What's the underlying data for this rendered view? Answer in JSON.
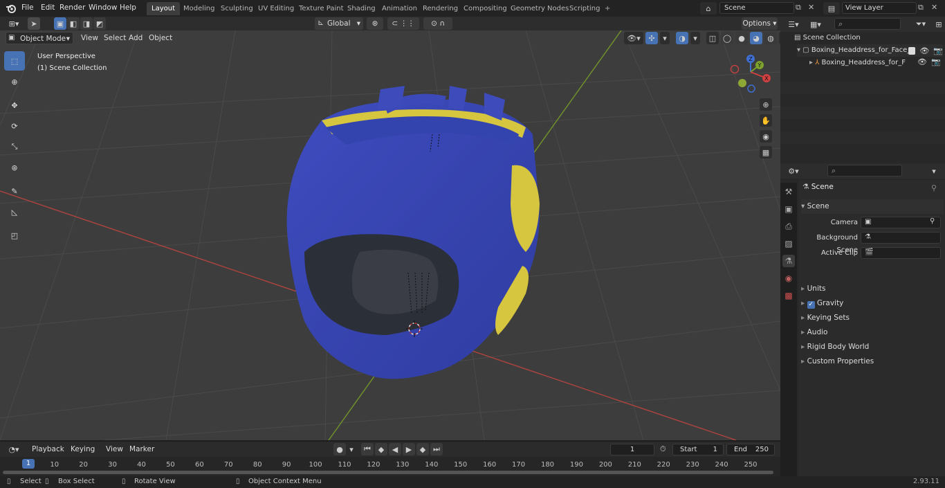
{
  "topbar": {
    "menus": [
      "File",
      "Edit",
      "Render",
      "Window",
      "Help"
    ],
    "workspaces": [
      "Layout",
      "Modeling",
      "Sculpting",
      "UV Editing",
      "Texture Paint",
      "Shading",
      "Animation",
      "Rendering",
      "Compositing",
      "Geometry Nodes",
      "Scripting"
    ],
    "active_workspace": "Layout",
    "add_tab": "+",
    "scene": "Scene",
    "view_layer": "View Layer"
  },
  "viewport_header": {
    "mode": "Object Mode",
    "menus": [
      "View",
      "Select",
      "Add",
      "Object"
    ],
    "orientation": "Global",
    "options": "Options"
  },
  "viewport": {
    "perspective_label": "User Perspective",
    "collection_label": "(1) Scene Collection",
    "gizmo": {
      "x": "X",
      "y": "Y",
      "z": "Z"
    },
    "colors": {
      "background": "#3d3d3d",
      "helmet": "#3b48b5",
      "trim": "#cfc23a",
      "x_axis": "#b04040",
      "y_axis": "#7c9a2a"
    }
  },
  "outliner": {
    "root": "Scene Collection",
    "items": [
      {
        "label": "Boxing_Headdress_for_Face_"
      },
      {
        "label": "Boxing_Headdress_for_F"
      }
    ]
  },
  "properties": {
    "context": "Scene",
    "panel_title": "Scene",
    "fields": [
      {
        "label": "Camera",
        "value": ""
      },
      {
        "label": "Background Scene",
        "value": ""
      },
      {
        "label": "Active Clip",
        "value": ""
      }
    ],
    "sections": [
      "Units",
      "Gravity",
      "Keying Sets",
      "Audio",
      "Rigid Body World",
      "Custom Properties"
    ]
  },
  "timeline": {
    "menus": [
      "Playback",
      "Keying",
      "View",
      "Marker"
    ],
    "current_frame": "1",
    "start_label": "Start",
    "start": "1",
    "end_label": "End",
    "end": "250",
    "ticks": [
      "10",
      "20",
      "30",
      "40",
      "50",
      "60",
      "70",
      "80",
      "90",
      "100",
      "110",
      "120",
      "130",
      "140",
      "150",
      "160",
      "170",
      "180",
      "190",
      "200",
      "210",
      "220",
      "230",
      "240",
      "250"
    ],
    "playhead": "1"
  },
  "statusbar": {
    "select": "Select",
    "box_select": "Box Select",
    "rotate_view": "Rotate View",
    "context_menu": "Object Context Menu",
    "version": "2.93.11"
  }
}
